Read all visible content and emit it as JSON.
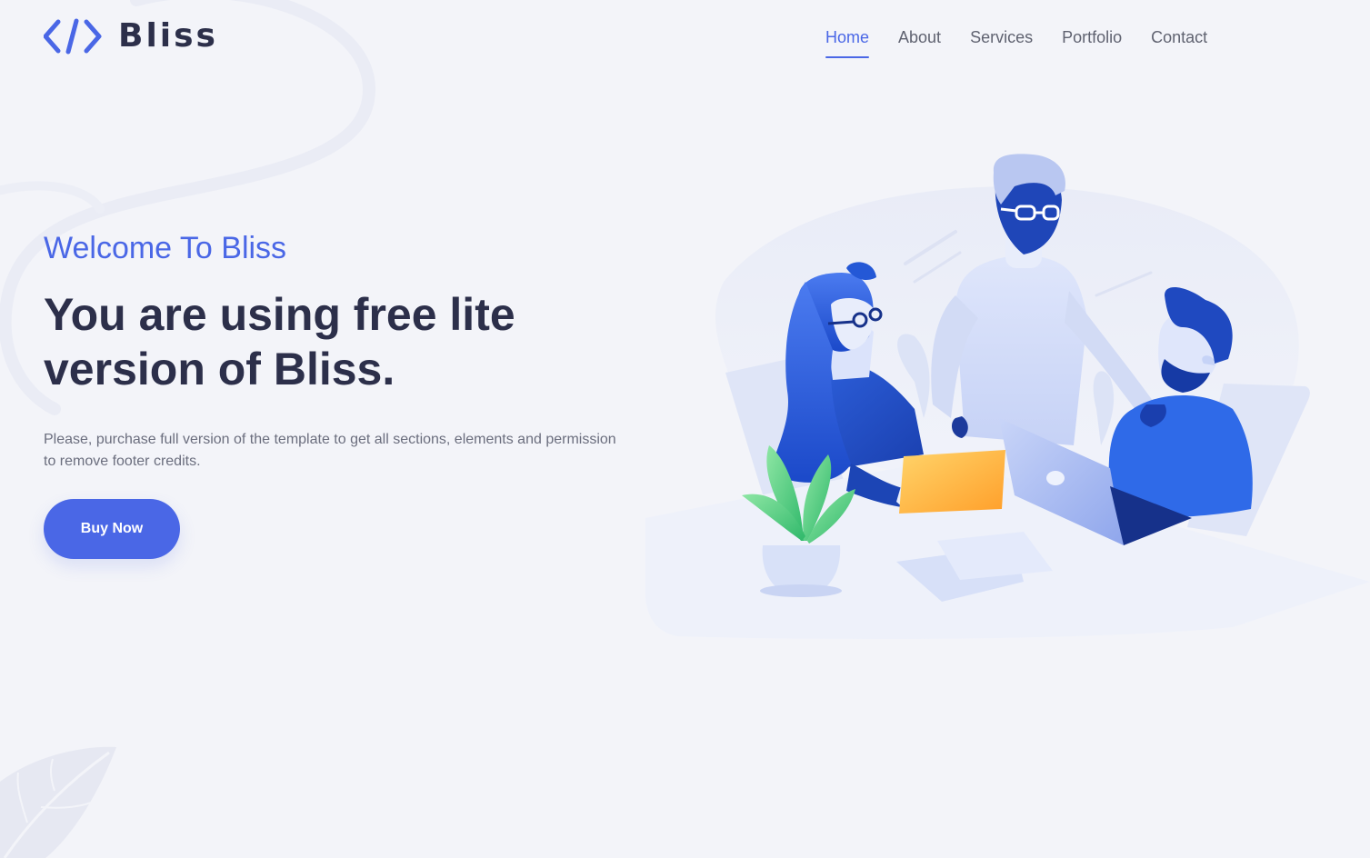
{
  "header": {
    "brand": "Bliss",
    "logo_icon": "code-brackets-icon",
    "nav": [
      {
        "label": "Home",
        "active": true
      },
      {
        "label": "About",
        "active": false
      },
      {
        "label": "Services",
        "active": false
      },
      {
        "label": "Portfolio",
        "active": false
      },
      {
        "label": "Contact",
        "active": false
      }
    ]
  },
  "hero": {
    "welcome": "Welcome To Bliss",
    "headline": "You are using free lite version of Bliss.",
    "description": "Please, purchase full version of the template to get all sections, elements and permission to remove footer credits.",
    "cta_label": "Buy Now",
    "illustration_icon": "team-meeting-illustration"
  },
  "colors": {
    "accent": "#4a67e6",
    "heading": "#2c2f4a",
    "background": "#f3f4f9",
    "body_text": "#6b6e7e"
  }
}
